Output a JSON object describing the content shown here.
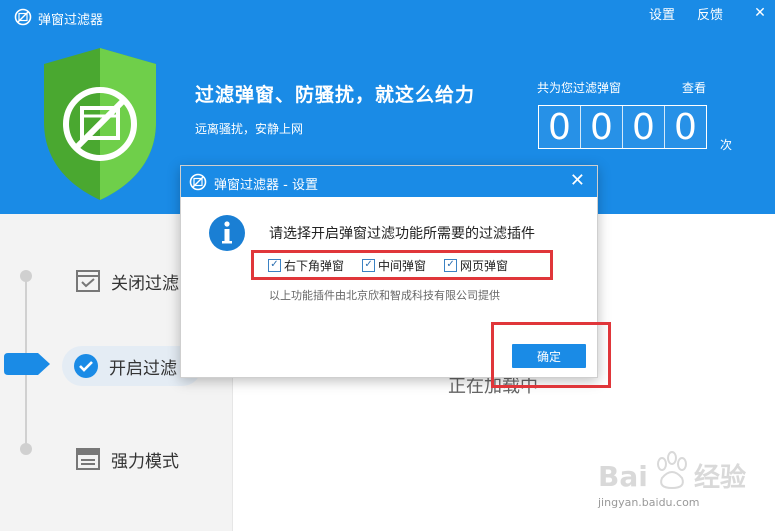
{
  "app": {
    "title": "弹窗过滤器",
    "links": [
      "设置",
      "反馈"
    ],
    "close_glyph": "✕"
  },
  "banner": {
    "headline": "过滤弹窗、防骚扰，就这么给力",
    "subline": "远离骚扰，安静上网",
    "counter_label": "共为您过滤弹窗",
    "counter_view": "查看",
    "counter_digits": [
      "0",
      "0",
      "0",
      "0"
    ],
    "counter_unit": "次"
  },
  "menu": {
    "items": [
      {
        "label": "关闭过滤",
        "icon": "checkbox-list-icon"
      },
      {
        "label": "开启过滤",
        "icon": "check-circle-icon"
      },
      {
        "label": "强力模式",
        "icon": "window-icon"
      }
    ],
    "selected": 1
  },
  "content": {
    "loading": "正在加载中"
  },
  "dialog": {
    "title": "弹窗过滤器 - 设置",
    "close_glyph": "✕",
    "message": "请选择开启弹窗过滤功能所需要的过滤插件",
    "options": [
      {
        "label": "右下角弹窗",
        "checked": true
      },
      {
        "label": "中间弹窗",
        "checked": true
      },
      {
        "label": "网页弹窗",
        "checked": true
      }
    ],
    "provider": "以上功能插件由北京欣和智成科技有限公司提供",
    "confirm_label": "确定",
    "check_glyph": "✓"
  },
  "watermark": {
    "brand": "Bai经验",
    "url": "jingyan.baidu.com"
  },
  "colors": {
    "brand_blue": "#1a8be6",
    "shield_green": "#5cbf3c",
    "highlight_red": "#e0363a"
  }
}
